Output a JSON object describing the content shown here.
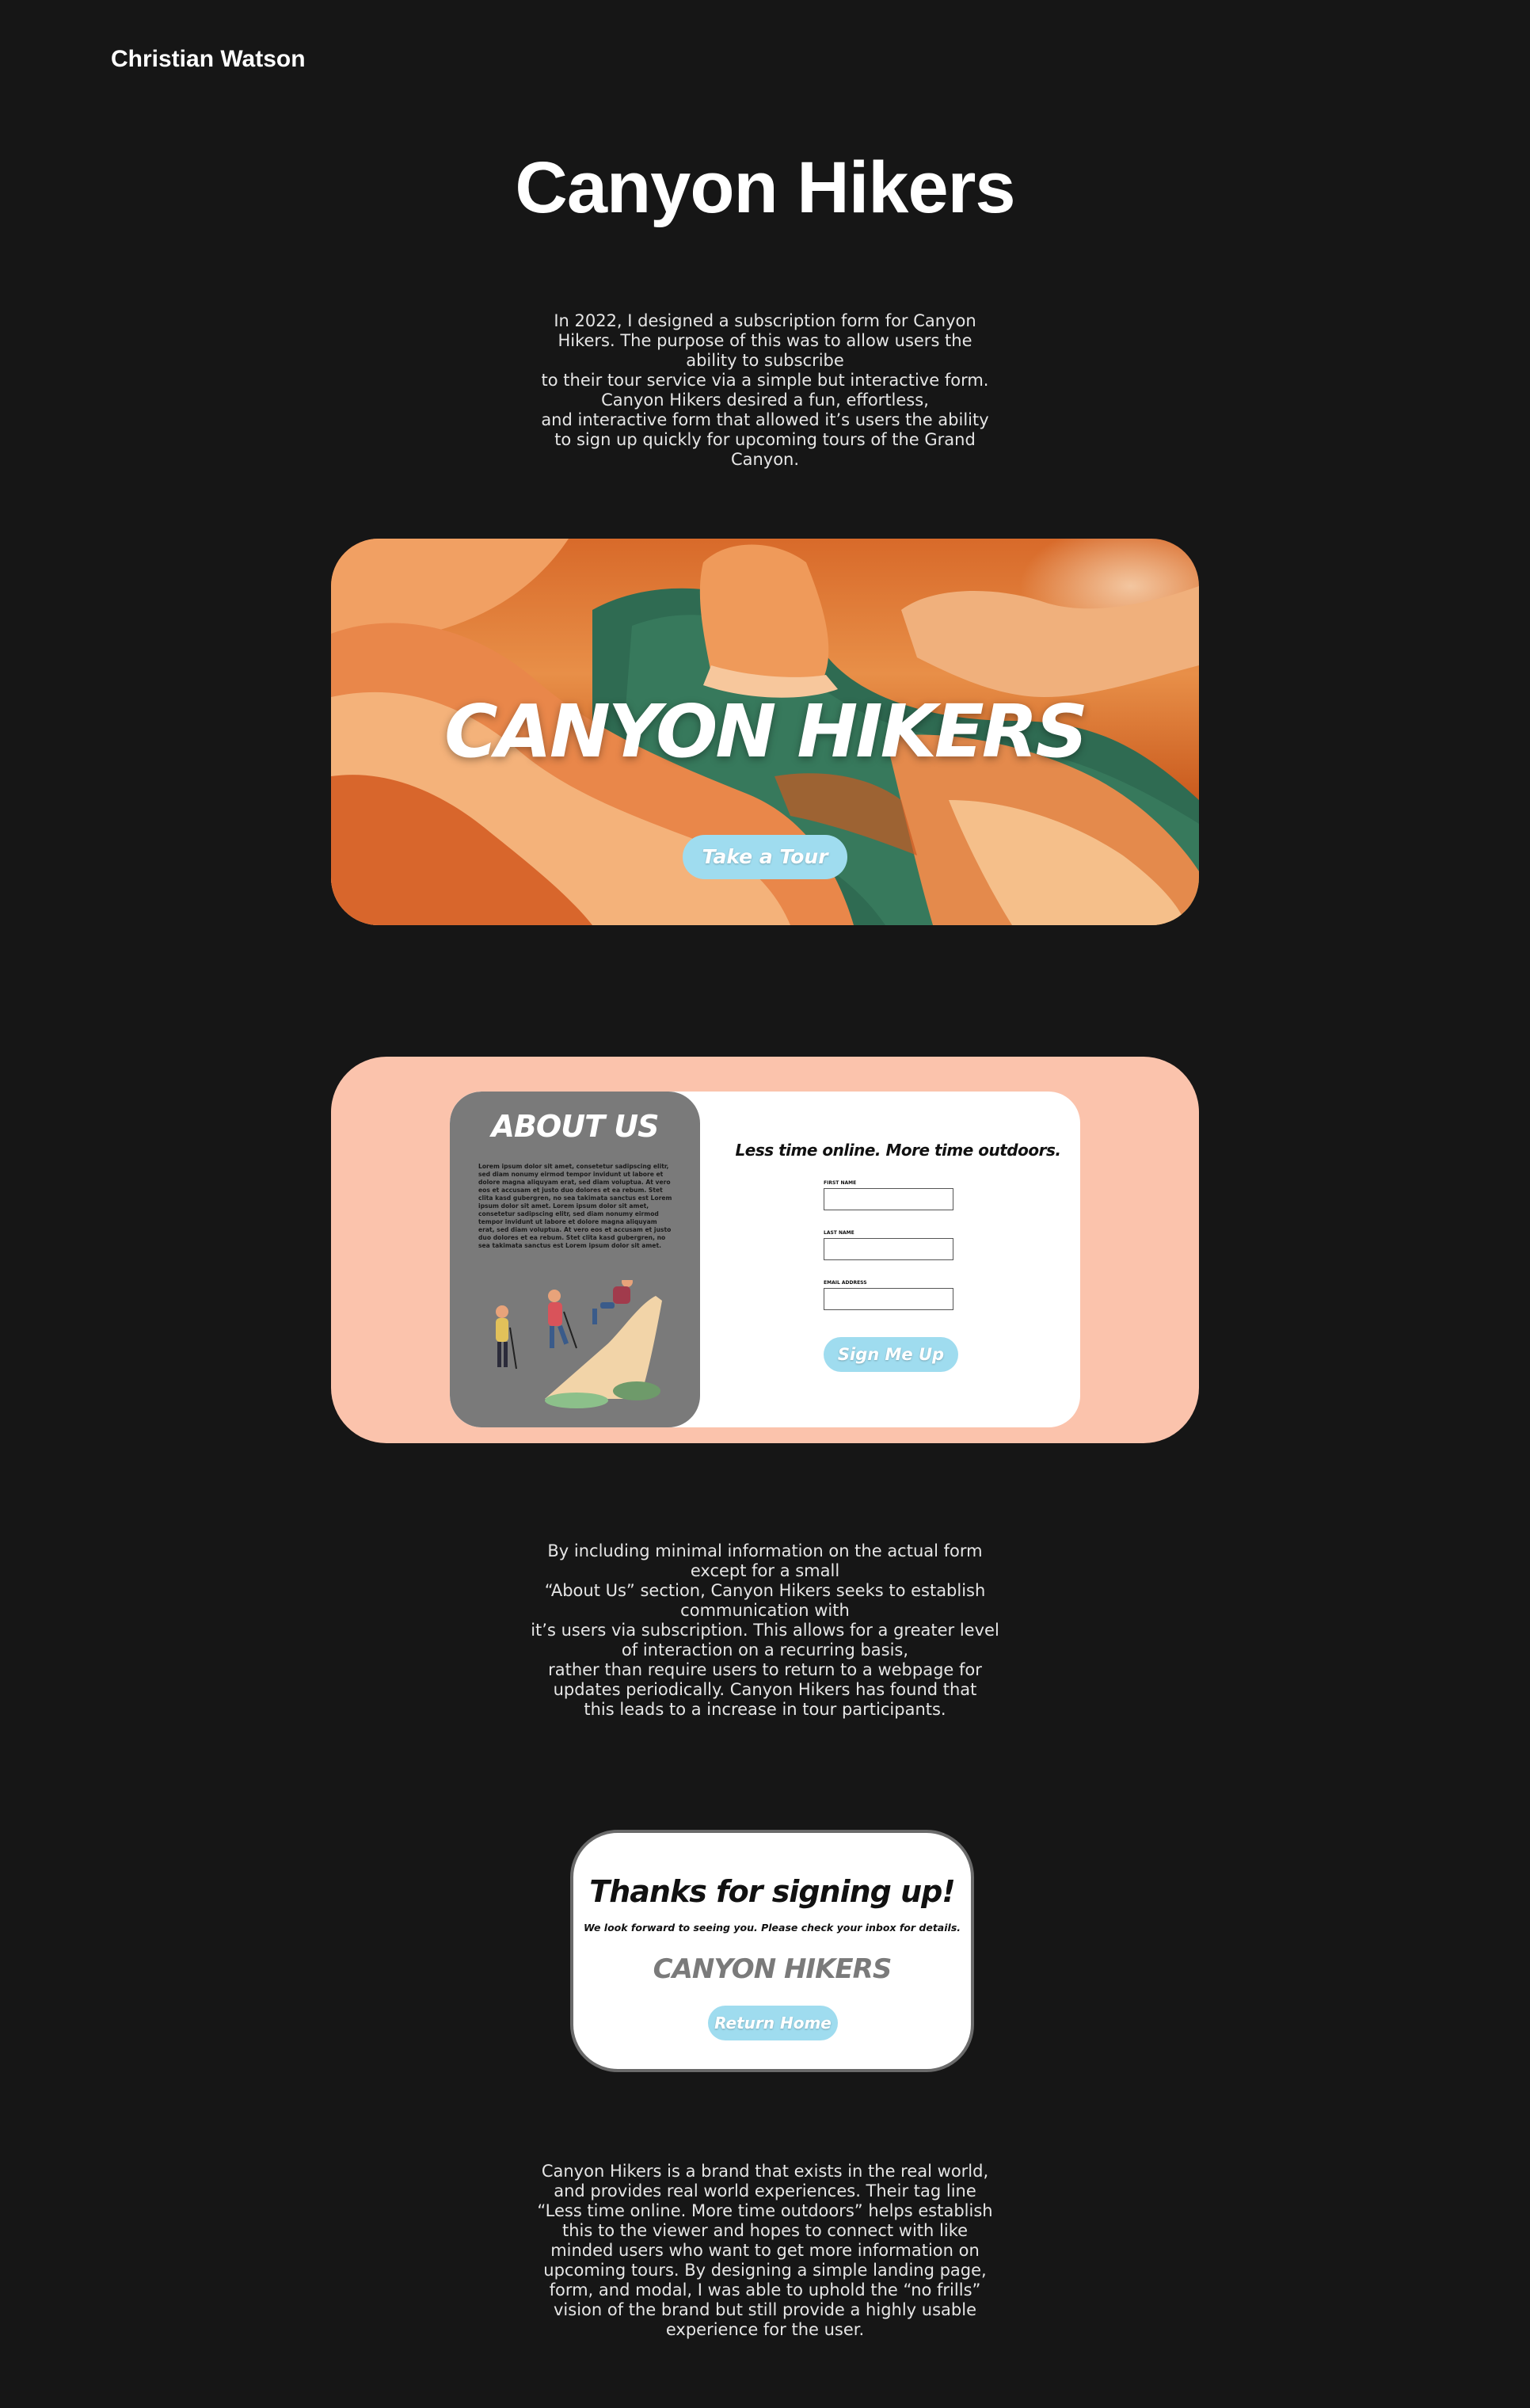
{
  "header": {
    "site_name": "Christian Watson"
  },
  "page": {
    "title": "Canyon Hikers"
  },
  "intro": {
    "lines": [
      "In 2022, I designed a subscription form for Canyon",
      "Hikers. The purpose of this was to allow users the",
      "ability to subscribe",
      "to their tour service via a simple but interactive form.",
      "Canyon Hikers desired a fun, effortless,",
      "and interactive form that allowed it’s users the ability",
      "to sign up quickly for upcoming tours of the Grand",
      "Canyon."
    ]
  },
  "hero": {
    "title": "CANYON HIKERS",
    "cta_label": "Take a Tour"
  },
  "form_mockup": {
    "about_title": "ABOUT US",
    "about_body": "Lorem ipsum dolor sit amet, consetetur sadipscing elitr, sed diam nonumy eirmod tempor invidunt ut labore et dolore magna aliquyam erat, sed diam voluptua. At vero eos et accusam et justo duo dolores et ea rebum. Stet clita kasd gubergren, no sea takimata sanctus est Lorem ipsum dolor sit amet. Lorem ipsum dolor sit amet, consetetur sadipscing elitr, sed diam nonumy eirmod tempor invidunt ut labore et dolore magna aliquyam erat, sed diam voluptua. At vero eos et accusam et justo duo dolores et ea rebum. Stet clita kasd gubergren, no sea takimata sanctus est Lorem ipsum dolor sit amet.",
    "tagline": "Less time online. More time outdoors.",
    "fields": {
      "first_name_label": "FIRST NAME",
      "last_name_label": "LAST NAME",
      "email_label": "EMAIL ADDRESS"
    },
    "submit_label": "Sign Me Up"
  },
  "middle": {
    "lines": [
      "By including minimal information on the actual form",
      "except for a small",
      "“About Us” section, Canyon Hikers seeks to establish",
      "communication with",
      "it’s users via subscription. This allows for a greater level",
      "of interaction on a recurring basis,",
      "rather than require users to return to a webpage for",
      "updates periodically. Canyon Hikers has found that",
      "this leads to a increase in tour participants."
    ]
  },
  "modal": {
    "title": "Thanks for signing up!",
    "subtitle": "We look forward to seeing you. Please check your inbox for details.",
    "brand": "CANYON HIKERS",
    "button_label": "Return Home"
  },
  "closing": {
    "lines": [
      "Canyon Hikers is a brand that exists in the real world,",
      "and provides real world experiences. Their tag line",
      "“Less time online. More time outdoors” helps establish",
      "this to the viewer and hopes to connect with like",
      "minded users who want to get more information on",
      "upcoming tours.  By designing a simple landing page,",
      "form, and modal, I was able to uphold the “no frills”",
      "vision of the brand but still provide a highly usable",
      "experience for the user."
    ]
  },
  "colors": {
    "background": "#161616",
    "accent_button": "#9fdcef",
    "form_card": "#fbc3ac",
    "about_panel": "#7a7a7a"
  }
}
